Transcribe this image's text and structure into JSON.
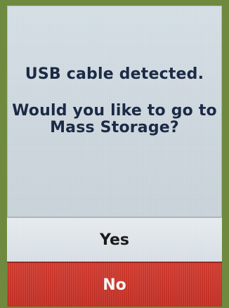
{
  "dialog": {
    "title": "USB cable detected.",
    "prompt_line1": "Would you like to go to",
    "prompt_line2": "Mass Storage?"
  },
  "buttons": {
    "yes_label": "Yes",
    "no_label": "No"
  },
  "colors": {
    "screen_background": "#c9d3da",
    "text_primary": "#1b2a45",
    "yes_button": "#d6dde3",
    "no_button": "#c9372c"
  }
}
